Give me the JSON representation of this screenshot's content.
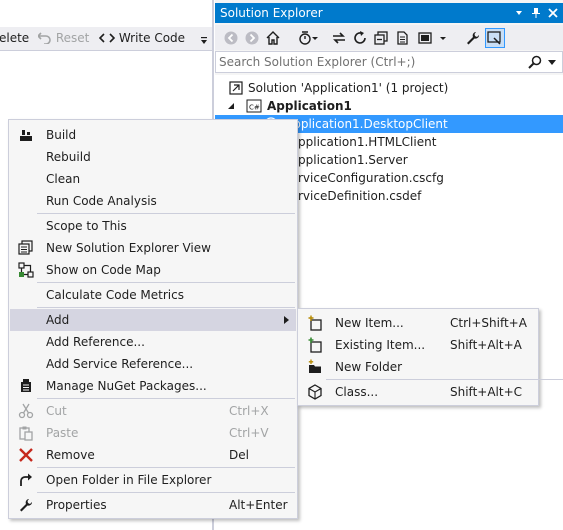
{
  "editor_toolbar": {
    "delete_label": "elete",
    "reset_label": "Reset",
    "write_code_label": "Write Code"
  },
  "solution_explorer": {
    "title": "Solution Explorer",
    "search_placeholder": "Search Solution Explorer (Ctrl+;)",
    "tree": {
      "solution": "Solution 'Application1' (1 project)",
      "project": "Application1",
      "items": [
        "Application1.DesktopClient",
        "pplication1.HTMLClient",
        "pplication1.Server",
        "rviceConfiguration.cscfg",
        "rviceDefinition.csdef"
      ]
    }
  },
  "context_menu": {
    "build": "Build",
    "rebuild": "Rebuild",
    "clean": "Clean",
    "run_code_analysis": "Run Code Analysis",
    "scope_to_this": "Scope to This",
    "new_solution_explorer_view": "New Solution Explorer View",
    "show_on_code_map": "Show on Code Map",
    "calculate_code_metrics": "Calculate Code Metrics",
    "add": "Add",
    "add_reference": "Add Reference...",
    "add_service_reference": "Add Service Reference...",
    "manage_nuget": "Manage NuGet Packages...",
    "cut": "Cut",
    "cut_shortcut": "Ctrl+X",
    "paste": "Paste",
    "paste_shortcut": "Ctrl+V",
    "remove": "Remove",
    "remove_shortcut": "Del",
    "open_folder": "Open Folder in File Explorer",
    "properties": "Properties",
    "properties_shortcut": "Alt+Enter"
  },
  "add_submenu": {
    "new_item": "New Item...",
    "new_item_shortcut": "Ctrl+Shift+A",
    "existing_item": "Existing Item...",
    "existing_item_shortcut": "Shift+Alt+A",
    "new_folder": "New Folder",
    "class": "Class...",
    "class_shortcut": "Shift+Alt+C"
  },
  "colors": {
    "accent": "#007acc",
    "selection": "#3399ff",
    "menu_background": "#f6f6f6",
    "menu_highlight": "#d5d5e1",
    "disabled_text": "#a2a4a5"
  }
}
